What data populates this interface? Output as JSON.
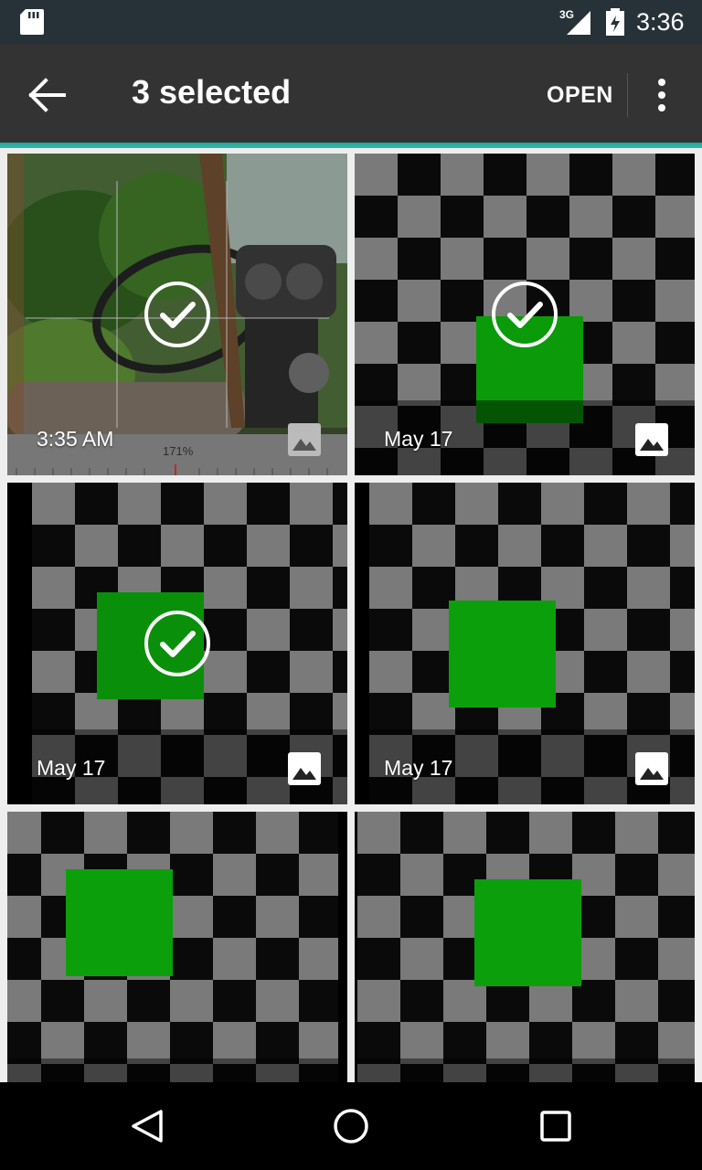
{
  "status_bar": {
    "network": "3G",
    "time": "3:36"
  },
  "action_bar": {
    "title": "3 selected",
    "open_label": "OPEN"
  },
  "tiles": [
    {
      "caption": "3:35 AM",
      "selected": true,
      "overlay_text": "171%"
    },
    {
      "caption": "May 17",
      "selected": true
    },
    {
      "caption": "May 17",
      "selected": true
    },
    {
      "caption": "May 17",
      "selected": false
    },
    {
      "caption": "",
      "selected": false
    },
    {
      "caption": "",
      "selected": false
    }
  ],
  "colors": {
    "accent": "#1da79a",
    "action_bar": "#333333",
    "status_bar": "#263238",
    "green_square": "#0a9a0a"
  }
}
